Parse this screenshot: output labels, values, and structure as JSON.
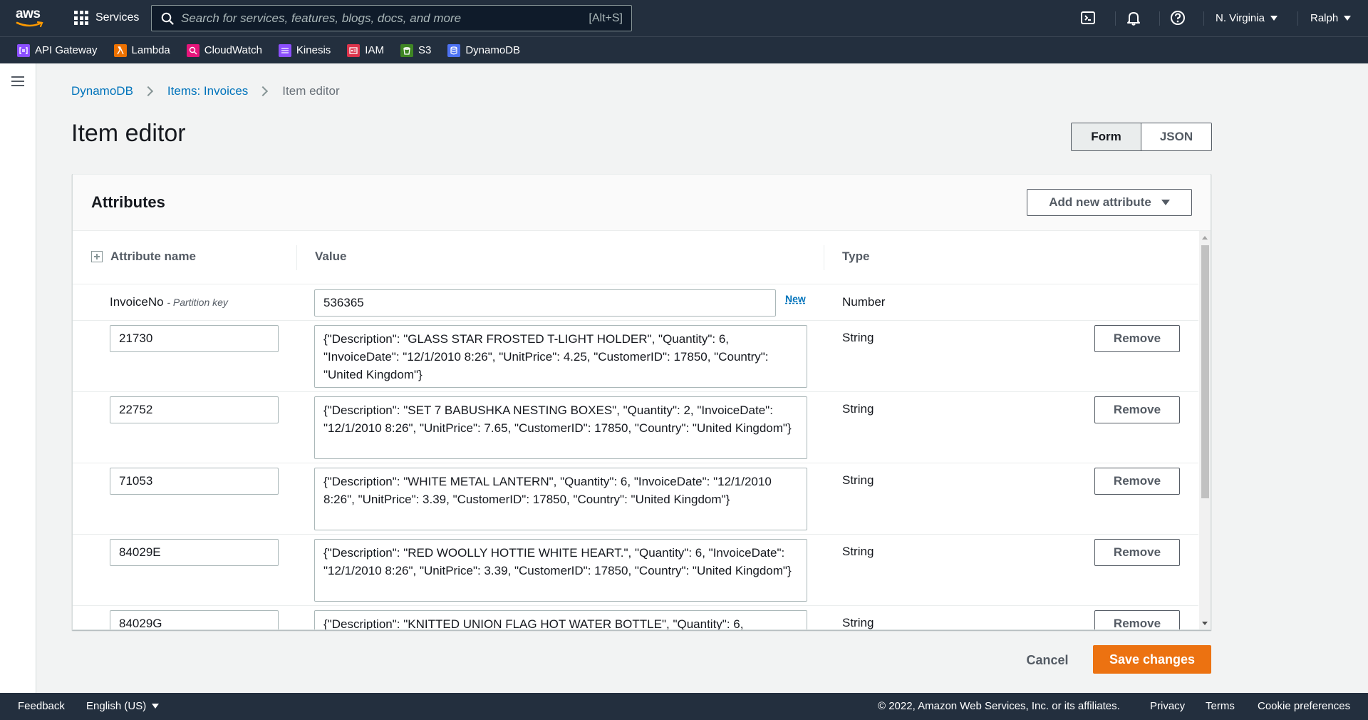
{
  "topnav": {
    "brand": "aws",
    "services_label": "Services",
    "search_placeholder": "Search for services, features, blogs, docs, and more",
    "search_shortcut": "[Alt+S]",
    "region": "N. Virginia",
    "user": "Ralph"
  },
  "favorites": [
    {
      "label": "API Gateway",
      "icon": "api-gateway-icon",
      "color": "#8c4fff"
    },
    {
      "label": "Lambda",
      "icon": "lambda-icon",
      "color": "#ed7100"
    },
    {
      "label": "CloudWatch",
      "icon": "cloudwatch-icon",
      "color": "#e7157b"
    },
    {
      "label": "Kinesis",
      "icon": "kinesis-icon",
      "color": "#8c4fff"
    },
    {
      "label": "IAM",
      "icon": "iam-icon",
      "color": "#dd344c"
    },
    {
      "label": "S3",
      "icon": "s3-icon",
      "color": "#3f8624"
    },
    {
      "label": "DynamoDB",
      "icon": "dynamodb-icon",
      "color": "#4d72f3"
    }
  ],
  "breadcrumb": {
    "items": [
      "DynamoDB",
      "Items: Invoices"
    ],
    "current": "Item editor"
  },
  "page": {
    "title": "Item editor",
    "view_form": "Form",
    "view_json": "JSON",
    "active_view": "Form"
  },
  "attributes": {
    "title": "Attributes",
    "add_button": "Add new attribute",
    "columns": [
      "Attribute name",
      "Value",
      "Type"
    ],
    "partition": {
      "name": "InvoiceNo",
      "key_label": "- Partition key",
      "value": "536365",
      "new_label": "New",
      "type": "Number"
    },
    "remove_label": "Remove",
    "rows": [
      {
        "name": "21730",
        "value": "{\"Description\": \"GLASS STAR FROSTED T-LIGHT HOLDER\", \"Quantity\": 6, \"InvoiceDate\": \"12/1/2010 8:26\", \"UnitPrice\": 4.25, \"CustomerID\": 17850, \"Country\": \"United Kingdom\"}",
        "type": "String"
      },
      {
        "name": "22752",
        "value": "{\"Description\": \"SET 7 BABUSHKA NESTING BOXES\", \"Quantity\": 2, \"InvoiceDate\": \"12/1/2010 8:26\", \"UnitPrice\": 7.65, \"CustomerID\": 17850, \"Country\": \"United Kingdom\"}",
        "type": "String"
      },
      {
        "name": "71053",
        "value": "{\"Description\": \"WHITE METAL LANTERN\", \"Quantity\": 6, \"InvoiceDate\": \"12/1/2010 8:26\", \"UnitPrice\": 3.39, \"CustomerID\": 17850, \"Country\": \"United Kingdom\"}",
        "type": "String"
      },
      {
        "name": "84029E",
        "value": "{\"Description\": \"RED WOOLLY HOTTIE WHITE HEART.\", \"Quantity\": 6, \"InvoiceDate\": \"12/1/2010 8:26\", \"UnitPrice\": 3.39, \"CustomerID\": 17850, \"Country\": \"United Kingdom\"}",
        "type": "String"
      },
      {
        "name": "84029G",
        "value": "{\"Description\": \"KNITTED UNION FLAG HOT WATER BOTTLE\", \"Quantity\": 6,",
        "type": "String"
      }
    ]
  },
  "actions": {
    "cancel": "Cancel",
    "save": "Save changes"
  },
  "footer": {
    "feedback": "Feedback",
    "language": "English (US)",
    "copyright": "© 2022, Amazon Web Services, Inc. or its affiliates.",
    "privacy": "Privacy",
    "terms": "Terms",
    "cookies": "Cookie preferences"
  },
  "colors": {
    "nav_bg": "#232f3e",
    "link": "#0073bb",
    "primary": "#ec7211"
  }
}
